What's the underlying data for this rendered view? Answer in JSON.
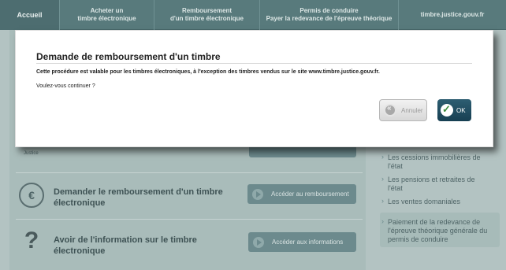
{
  "nav": {
    "home": "Accueil",
    "item1": [
      "Acheter un",
      "timbre électronique"
    ],
    "item2": [
      "Remboursement",
      "d'un timbre électronique"
    ],
    "item3": [
      "Permis de conduire",
      "Payer la redevance de l'épreuve théorique"
    ],
    "item4": "timbre.justice.gouv.fr"
  },
  "main": {
    "partial_text": "Justice",
    "rows": [
      {
        "title": "Demander le remboursement d'un timbre électronique",
        "button": "Accéder au remboursement",
        "icon": "euro-icon"
      },
      {
        "title": "Avoir de l'information sur le timbre électronique",
        "button": "Accéder aux informations",
        "icon": "question-icon"
      }
    ]
  },
  "sidebar": {
    "links": [
      "Les cessions immobilières de l'état",
      "Les pensions et retraites de l'état",
      "Les ventes domaniales"
    ],
    "box_text": "Paiement de la redevance de l'épreuve théorique générale du permis de conduire"
  },
  "modal": {
    "title": "Demande de remboursement d'un timbre",
    "text1": "Cette procédure est valable pour les timbres électroniques, à l'exception des timbres vendus sur le site www.timbre.justice.gouv.fr.",
    "text2": "Voulez-vous continuer ?",
    "cancel_label": "Annuler",
    "ok_label": "OK"
  }
}
